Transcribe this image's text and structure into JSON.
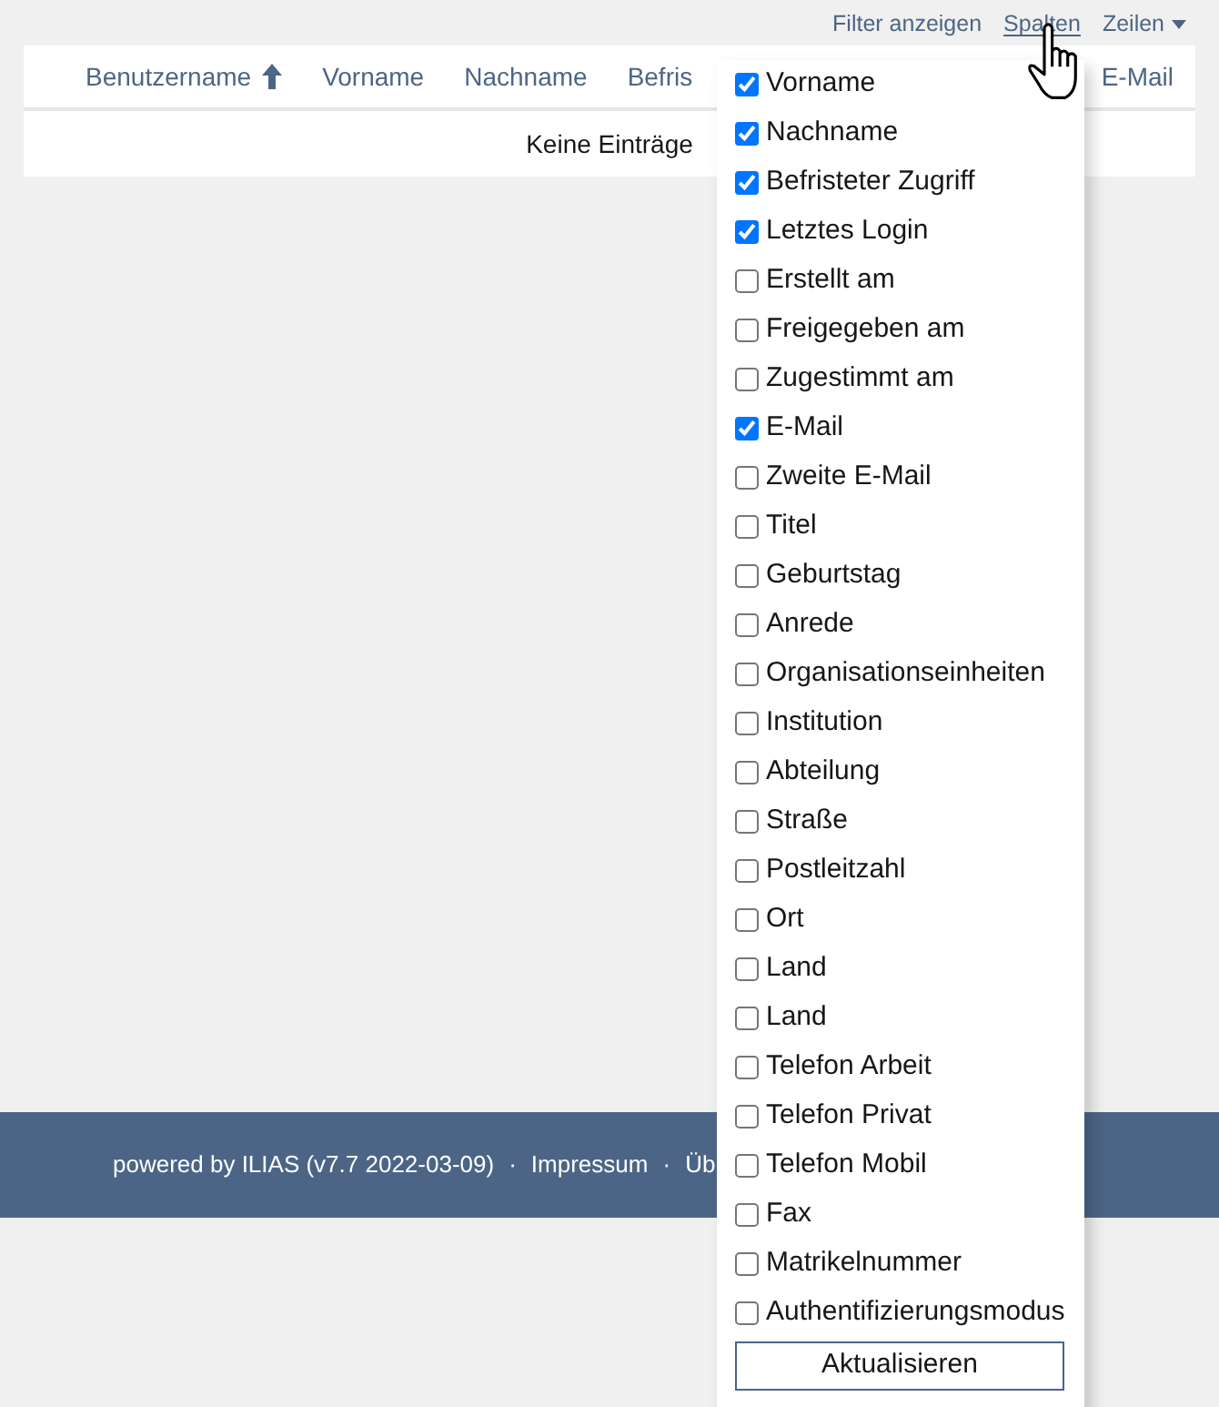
{
  "toolbar": [
    {
      "label": "Filter anzeigen",
      "kind": "link",
      "expanded": false
    },
    {
      "label": "Spalten",
      "kind": "link",
      "expanded": true
    },
    {
      "label": "Zeilen",
      "kind": "dropdown",
      "expanded": false
    }
  ],
  "table": {
    "columns": [
      {
        "label": "Benutzername",
        "sorted": true
      },
      {
        "label": "Vorname",
        "sorted": false
      },
      {
        "label": "Nachname",
        "sorted": false
      },
      {
        "label": "Befris",
        "sorted": false
      },
      {
        "label": "E-Mail",
        "sorted": false
      }
    ],
    "empty_message": "Keine Einträge"
  },
  "column_menu": {
    "items": [
      {
        "label": "Vorname",
        "checked": true
      },
      {
        "label": "Nachname",
        "checked": true
      },
      {
        "label": "Befristeter Zugriff",
        "checked": true
      },
      {
        "label": "Letztes Login",
        "checked": true
      },
      {
        "label": "Erstellt am",
        "checked": false
      },
      {
        "label": "Freigegeben am",
        "checked": false
      },
      {
        "label": "Zugestimmt am",
        "checked": false
      },
      {
        "label": "E-Mail",
        "checked": true
      },
      {
        "label": "Zweite E-Mail",
        "checked": false
      },
      {
        "label": "Titel",
        "checked": false
      },
      {
        "label": "Geburtstag",
        "checked": false
      },
      {
        "label": "Anrede",
        "checked": false
      },
      {
        "label": "Organisationseinheiten",
        "checked": false
      },
      {
        "label": "Institution",
        "checked": false
      },
      {
        "label": "Abteilung",
        "checked": false
      },
      {
        "label": "Straße",
        "checked": false
      },
      {
        "label": "Postleitzahl",
        "checked": false
      },
      {
        "label": "Ort",
        "checked": false
      },
      {
        "label": "Land",
        "checked": false
      },
      {
        "label": "Land",
        "checked": false
      },
      {
        "label": "Telefon Arbeit",
        "checked": false
      },
      {
        "label": "Telefon Privat",
        "checked": false
      },
      {
        "label": "Telefon Mobil",
        "checked": false
      },
      {
        "label": "Fax",
        "checked": false
      },
      {
        "label": "Matrikelnummer",
        "checked": false
      },
      {
        "label": "Authentifizierungsmodus",
        "checked": false
      }
    ],
    "button": "Aktualisieren"
  },
  "footer": {
    "credit": "powered by ILIAS (v7.7 2022-03-09)",
    "links": [
      {
        "separator": "·",
        "label": "Impressum"
      },
      {
        "separator": "·",
        "label": "Üb"
      }
    ]
  }
}
